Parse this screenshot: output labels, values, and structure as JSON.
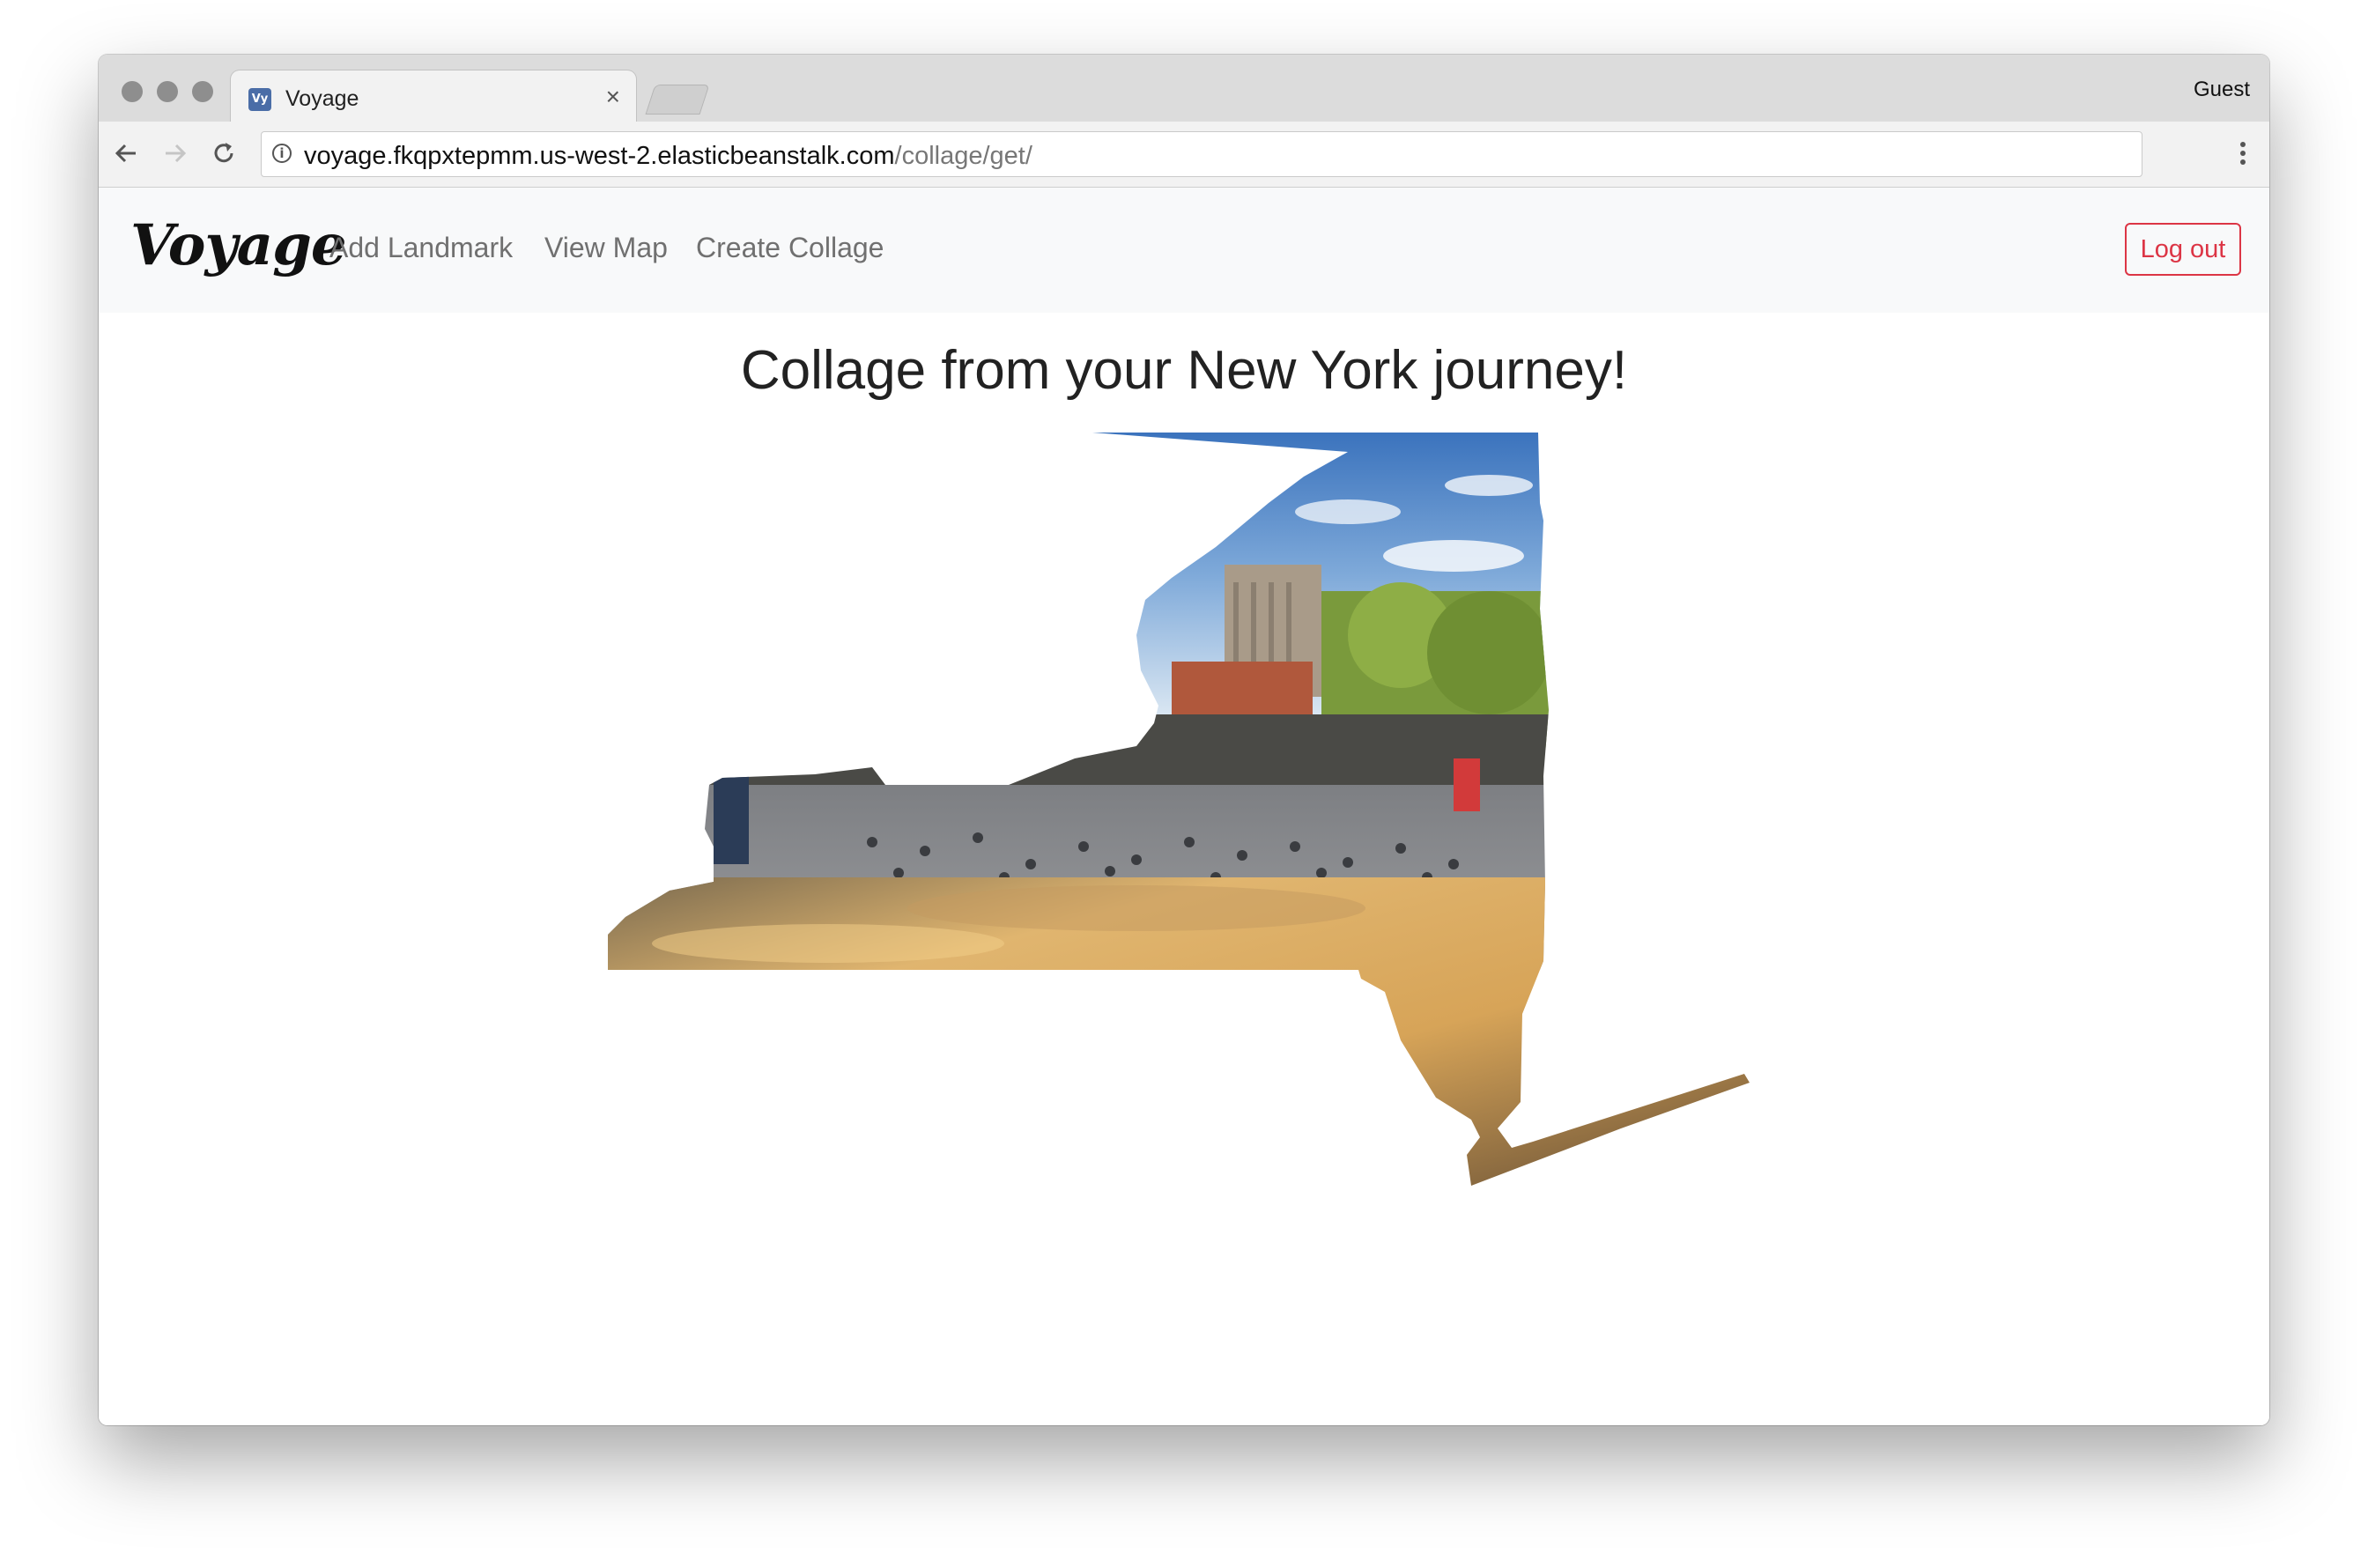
{
  "browser": {
    "tab_title": "Voyage",
    "tab_close": "×",
    "favicon": "Vy",
    "profile": "Guest",
    "url_host": "voyage.fkqpxtepmm.us-west-2.elasticbeanstalk.com",
    "url_path": "/collage/get/",
    "icons": {
      "back": "back-arrow-icon",
      "forward": "forward-arrow-icon",
      "reload": "reload-icon",
      "info": "info-icon",
      "menu": "kebab-menu-icon"
    }
  },
  "navbar": {
    "brand": "Voyage",
    "links": [
      "Add Landmark",
      "View Map",
      "Create Collage"
    ],
    "logout": "Log out",
    "logout_color": "#dc3545"
  },
  "main": {
    "heading": "Collage from your New York journey!",
    "collage": {
      "shape": "New York State outline",
      "segments": [
        "Washington Square Park with pigeons and buildings",
        "golden sunset sky"
      ]
    }
  }
}
